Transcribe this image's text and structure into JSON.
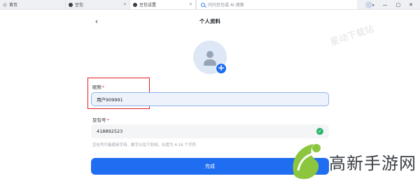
{
  "tabs": [
    {
      "label": "首页"
    },
    {
      "label": "豆包"
    },
    {
      "label": "豆包设置"
    }
  ],
  "address_bar": {
    "placeholder": "问问豆包或 AI 搜索"
  },
  "header": {
    "title": "个人资料",
    "back_icon": "chevron-left-icon"
  },
  "avatar": {
    "add_icon": "plus-icon"
  },
  "nickname": {
    "label": "昵称",
    "required_mark": "*",
    "value": "用户909991"
  },
  "doubao_id": {
    "label": "豆包号",
    "required_mark": "*",
    "value": "418892523",
    "status_icon": "check-circle-icon"
  },
  "hint": "豆包号只能使用字母、数字以及下划线，长度为 4-16 个字符",
  "submit_label": "完成",
  "watermarks": {
    "site_text": "星动下载站",
    "brand_text": "高新手游网"
  },
  "colors": {
    "accent": "#1f6df0",
    "success": "#2fb36b",
    "required": "#f23d3d",
    "highlight": "#e02020"
  }
}
